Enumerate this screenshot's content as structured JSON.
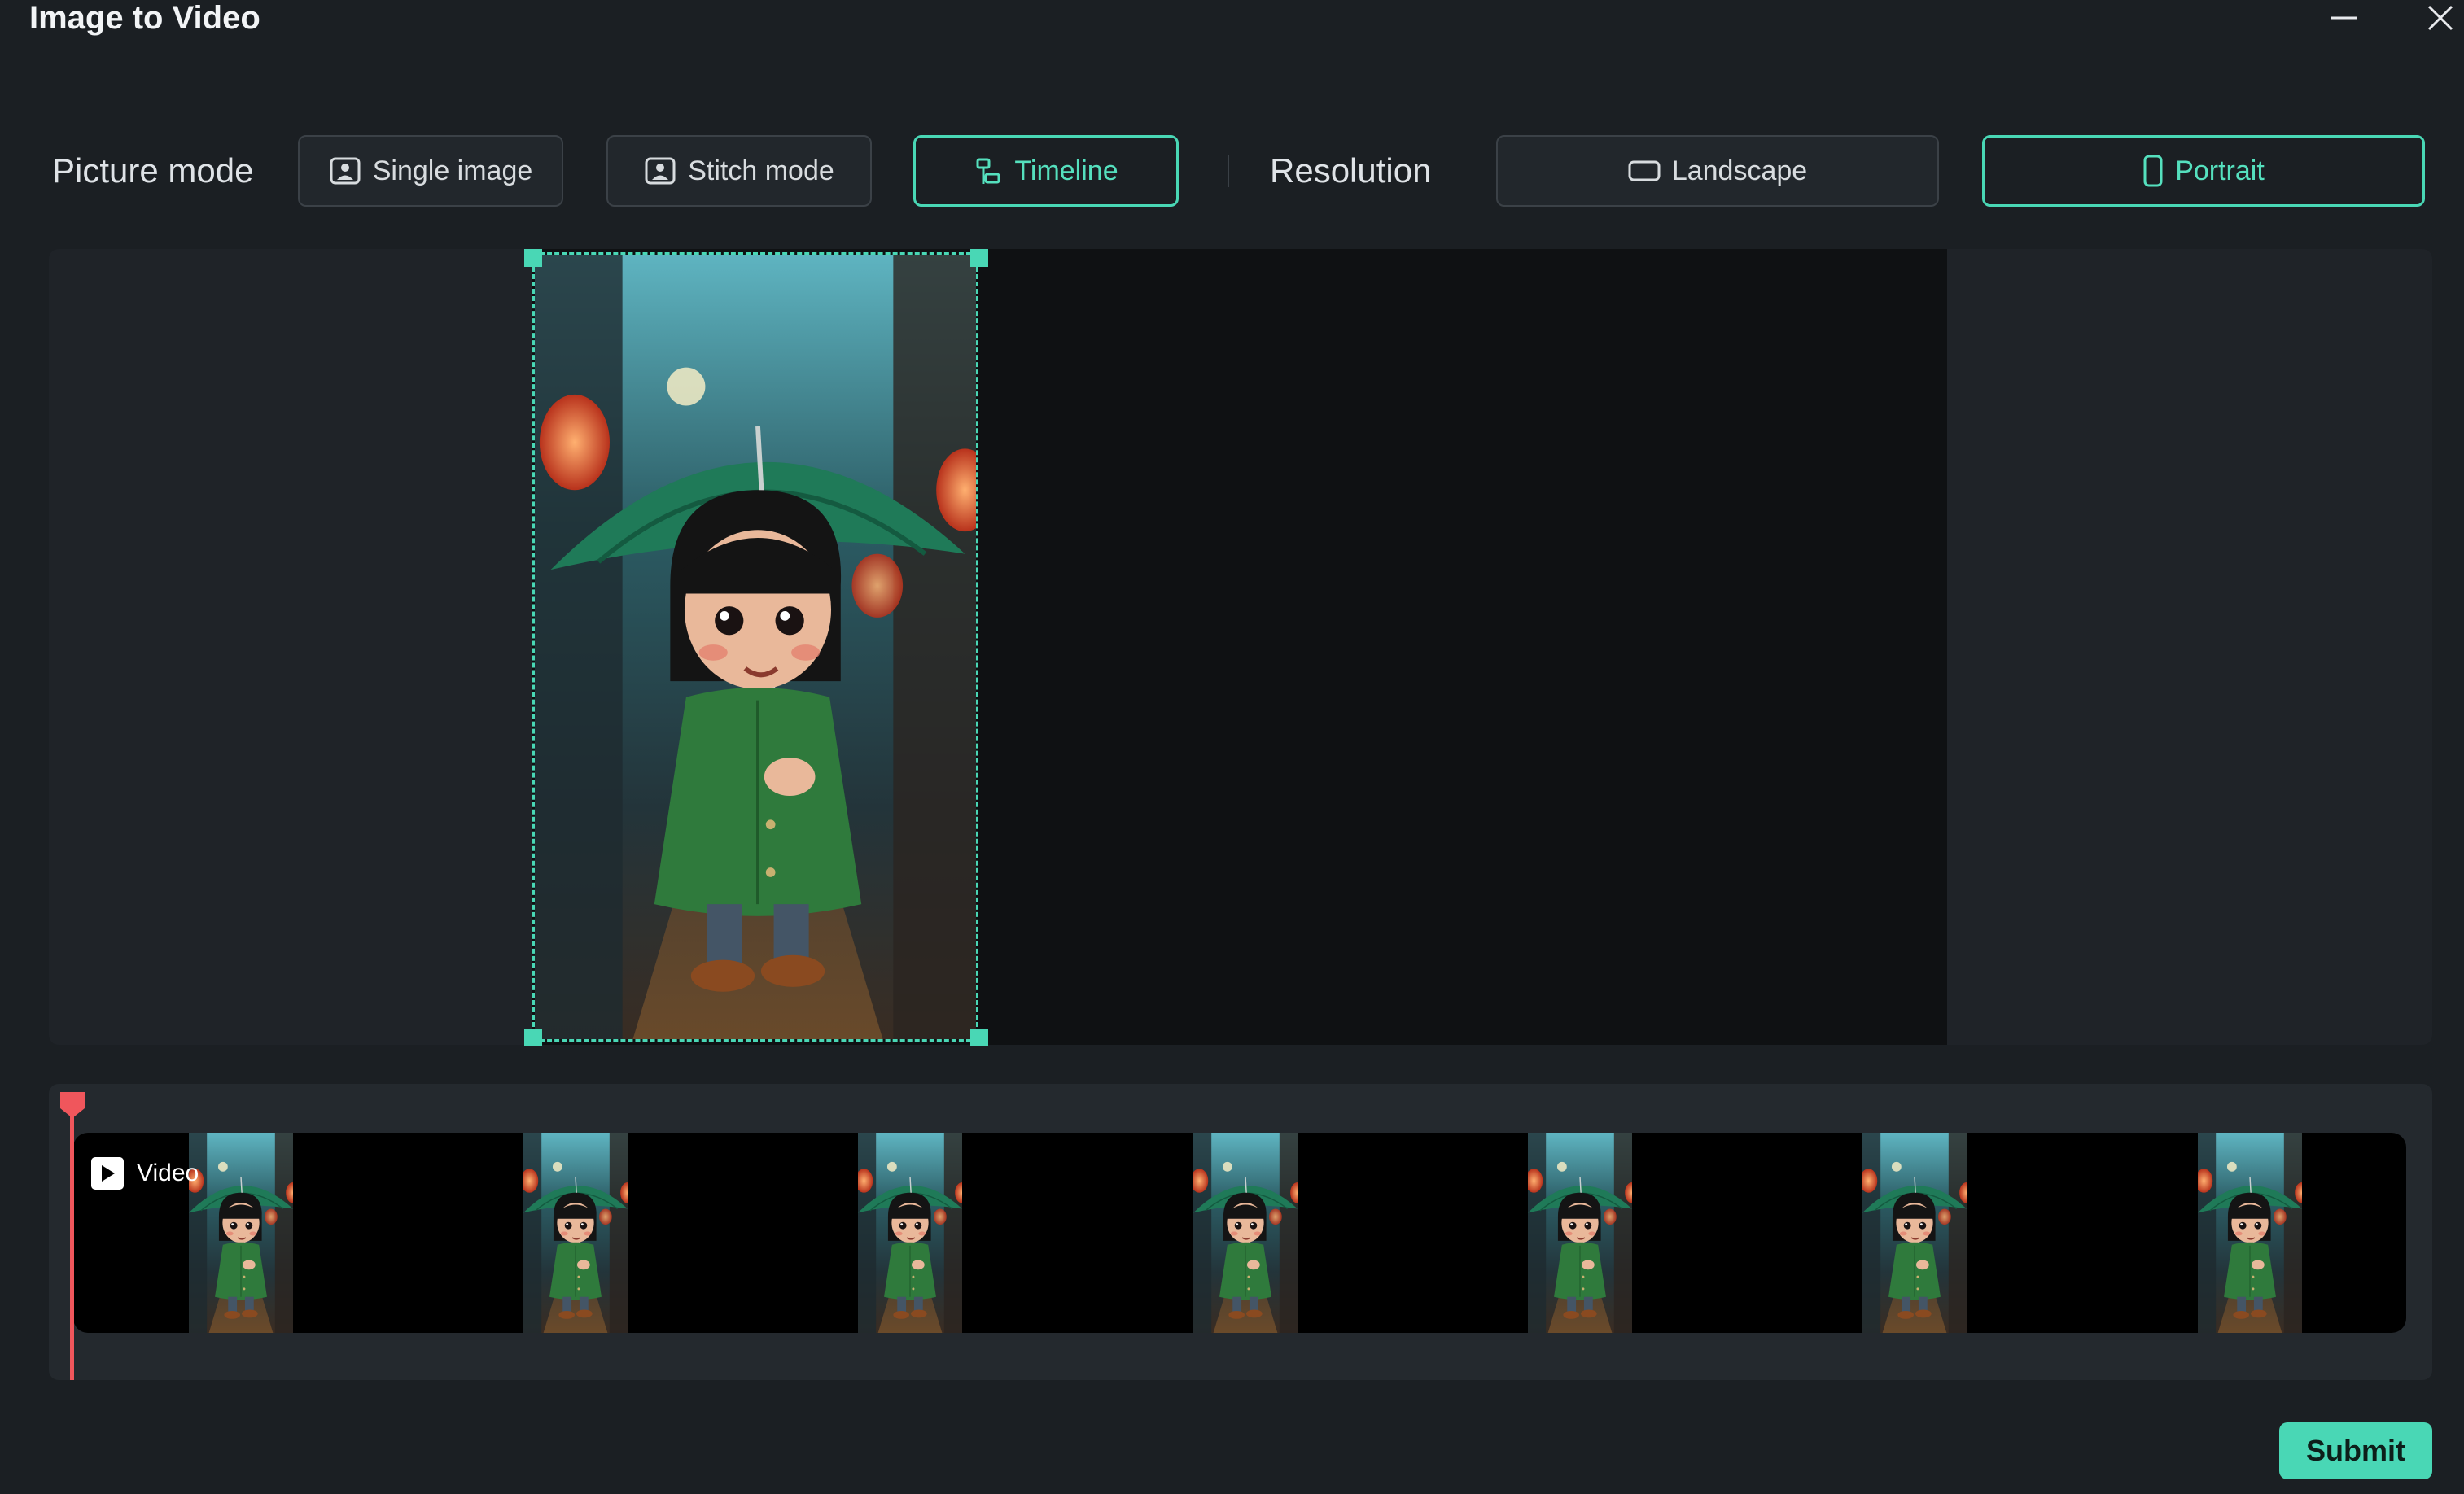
{
  "window": {
    "title": "Image to Video"
  },
  "toolbar": {
    "picture_mode_label": "Picture mode",
    "modes": [
      {
        "label": "Single image",
        "icon": "image-portrait-icon",
        "active": false
      },
      {
        "label": "Stitch mode",
        "icon": "image-portrait-icon",
        "active": false
      },
      {
        "label": "Timeline",
        "icon": "timeline-icon",
        "active": true
      }
    ],
    "resolution_label": "Resolution",
    "resolutions": [
      {
        "label": "Landscape",
        "icon": "landscape-icon",
        "active": false
      },
      {
        "label": "Portrait",
        "icon": "portrait-icon",
        "active": true
      }
    ]
  },
  "timeline": {
    "track_label": "Video",
    "thumbnail_count": 7
  },
  "footer": {
    "submit_label": "Submit"
  },
  "colors": {
    "accent": "#49d7b5",
    "playhead": "#f0565c",
    "background": "#1b1f23"
  }
}
